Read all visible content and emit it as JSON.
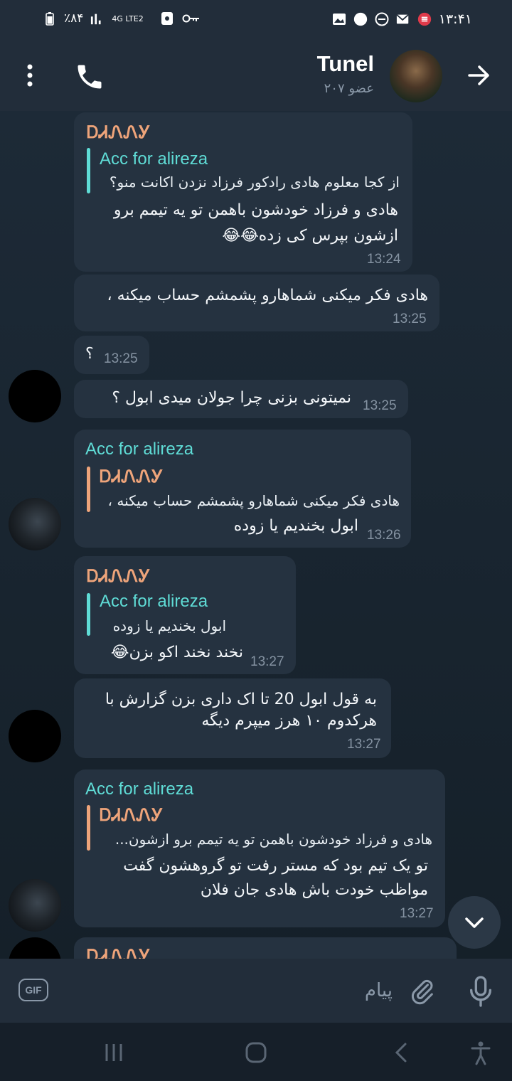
{
  "status_bar": {
    "battery": "٪۸۴",
    "network": "4G LTE2",
    "time": "۱۳:۴۱"
  },
  "header": {
    "title": "Tunel",
    "subtitle": "۲۰۷ عضو"
  },
  "messages": [
    {
      "sender": "ᎠᏗᏁᏁᎩ",
      "quote_name": "Acc for alireza",
      "quote_text": "از کجا معلوم هادی رادکور فرزاد نزدن اکانت منو؟",
      "text_line1": "هادی و فرزاد خودشون باهمن تو یه تیمم برو",
      "text_line2": "ازشون بپرس کی زده😂😂",
      "time": "13:24"
    },
    {
      "text": "هادی فکر میکنی شماهارو پشمشم حساب میکنه ،",
      "time": "13:25"
    },
    {
      "text": "؟",
      "time": "13:25"
    },
    {
      "text": "نمیتونی بزنی چرا جولان میدی ابول ؟",
      "time": "13:25"
    },
    {
      "sender": "Acc for alireza",
      "quote_name": "ᎠᏗᏁᏁᎩ",
      "quote_text": "هادی فکر میکنی شماهارو پشمشم حساب میکنه ،",
      "text": "ابول بخندیم یا زوده",
      "time": "13:26"
    },
    {
      "sender": "ᎠᏗᏁᏁᎩ",
      "quote_name": "Acc for alireza",
      "quote_text": "ابول بخندیم یا زوده",
      "text": "نخند نخند اکو بزن😂",
      "time": "13:27"
    },
    {
      "text_line1": "به قول ابول 20 تا اک داری بزن گزارش با",
      "text_line2": "هرکدوم ۱۰ هرز میپرم دیگه",
      "time": "13:27"
    },
    {
      "sender": "Acc for alireza",
      "quote_name": "ᎠᏗᏁᏁᎩ",
      "quote_text": "هادی و فرزاد خودشون باهمن تو یه تیمم برو ازشون...",
      "text_line1": "تو یک تیم بود که مستر رفت تو گروهشون گفت",
      "text_line2": "مواظب خودت باش هادی جان فلان",
      "time": "13:27"
    },
    {
      "sender": "ᎠᏗᏁᏁᎩ"
    }
  ],
  "input": {
    "gif_label": "GIF",
    "placeholder": "پیام"
  },
  "icons": {
    "menu": "more-vertical-icon",
    "call": "phone-icon",
    "back": "arrow-right-icon",
    "scroll": "chevron-down-icon",
    "attach": "paperclip-icon",
    "mic": "microphone-icon"
  }
}
